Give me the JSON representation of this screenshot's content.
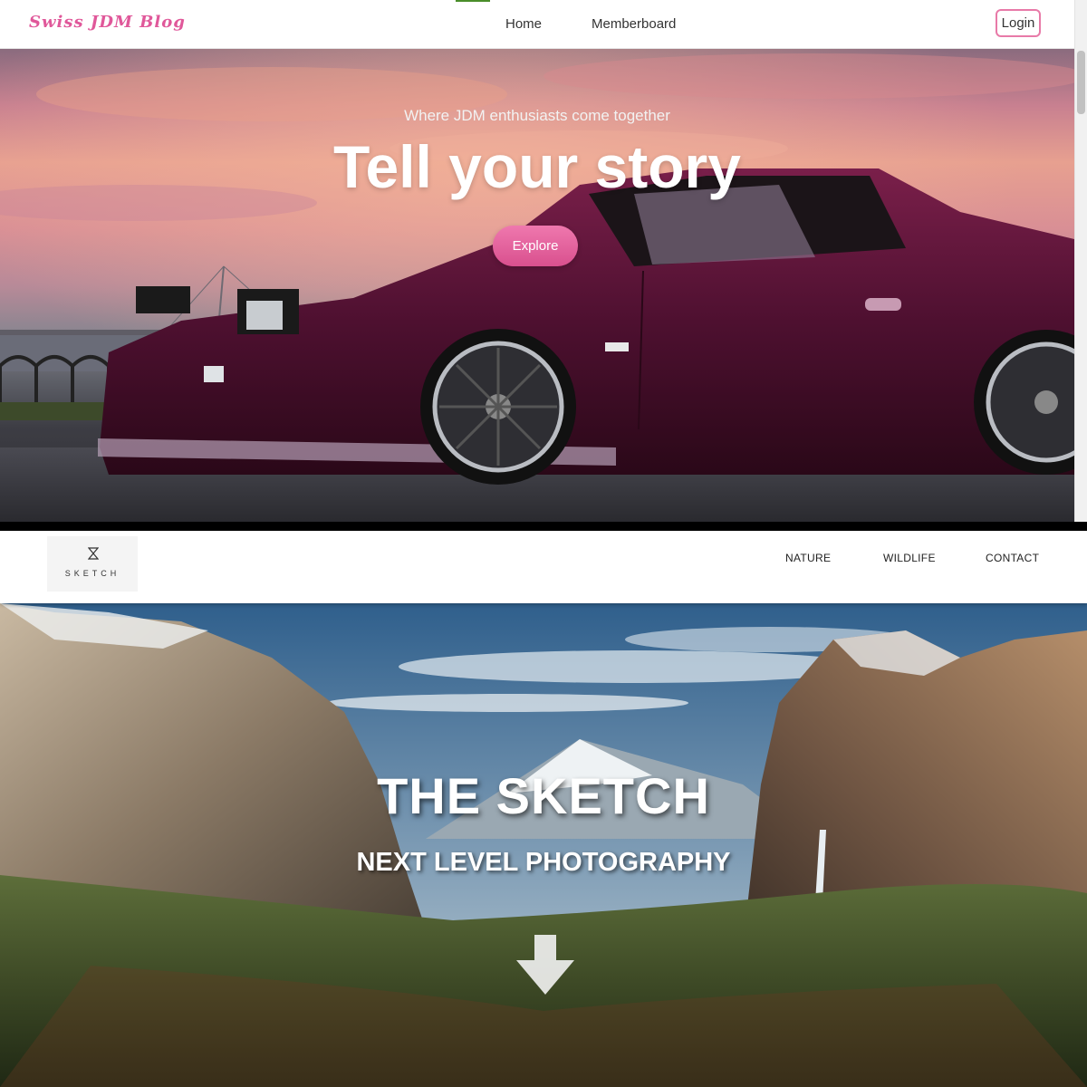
{
  "site1": {
    "logo": "Swiss JDM Blog",
    "nav": {
      "home": "Home",
      "memberboard": "Memberboard"
    },
    "login_label": "Login",
    "hero": {
      "subtitle": "Where JDM enthusiasts come together",
      "title": "Tell your story",
      "button_label": "Explore"
    },
    "colors": {
      "brand_pink": "#e0589a",
      "button_pink": "#e9689f",
      "active_tab": "#4a8d2a"
    }
  },
  "site2": {
    "logo_text": "SKETCH",
    "logo_icon": "hourglass-icon",
    "nav": {
      "nature": "NATURE",
      "wildlife": "WILDLIFE",
      "contact": "CONTACT"
    },
    "hero": {
      "title": "THE SKETCH",
      "subtitle": "NEXT LEVEL PHOTOGRAPHY",
      "arrow_icon": "arrow-down-icon"
    }
  }
}
